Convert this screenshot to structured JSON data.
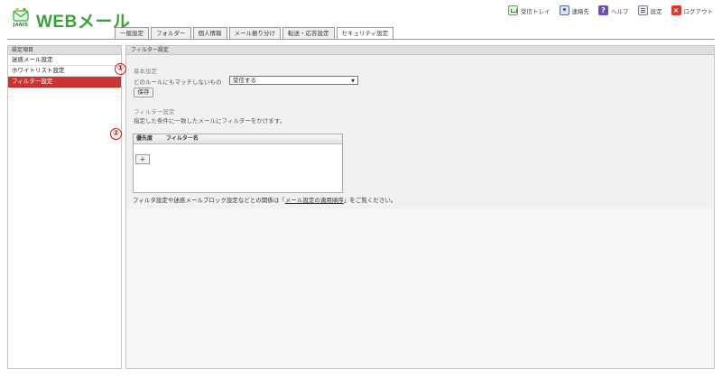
{
  "header": {
    "brand": "JANIS",
    "title": "WEBメール",
    "nav": [
      {
        "label": "受信トレイ",
        "icon": "inbox-icon"
      },
      {
        "label": "連絡先",
        "icon": "contacts-icon"
      },
      {
        "label": "ヘルプ",
        "icon": "help-icon"
      },
      {
        "label": "設定",
        "icon": "settings-icon"
      },
      {
        "label": "ログアウト",
        "icon": "logout-icon"
      }
    ],
    "help_glyph": "?",
    "logout_glyph": "×"
  },
  "tabs": [
    {
      "label": "一般設定"
    },
    {
      "label": "フォルダー"
    },
    {
      "label": "個人情報"
    },
    {
      "label": "メール振り分け"
    },
    {
      "label": "転送・応答設定"
    },
    {
      "label": "セキュリティ設定",
      "active": true
    }
  ],
  "sidebar": {
    "heading": "設定項目",
    "items": [
      {
        "label": "迷惑メール設定"
      },
      {
        "label": "ホワイトリスト設定"
      },
      {
        "label": "フィルター設定",
        "active": true
      }
    ]
  },
  "main": {
    "heading": "フィルター設定",
    "basic": {
      "title": "基本設定",
      "label": "どのルールにもマッチしないもの",
      "select_value": "受信する",
      "save_label": "保存"
    },
    "filter": {
      "title": "フィルター設定",
      "description": "指定した条件に一致したメールにフィルターをかけます。",
      "col_priority": "優先度",
      "col_name": "フィルター名",
      "add_label": "+"
    },
    "note": {
      "before": "フィルタ設定や迷惑メールブロック設定などとの関係は「",
      "link": "メール設定の適用順序",
      "after": "」をご覧ください。"
    }
  },
  "annotations": {
    "one": "①",
    "two": "②"
  },
  "colors": {
    "accent_green": "#3aa335",
    "active_red": "#cc3333",
    "badge_red": "#cc1111"
  }
}
